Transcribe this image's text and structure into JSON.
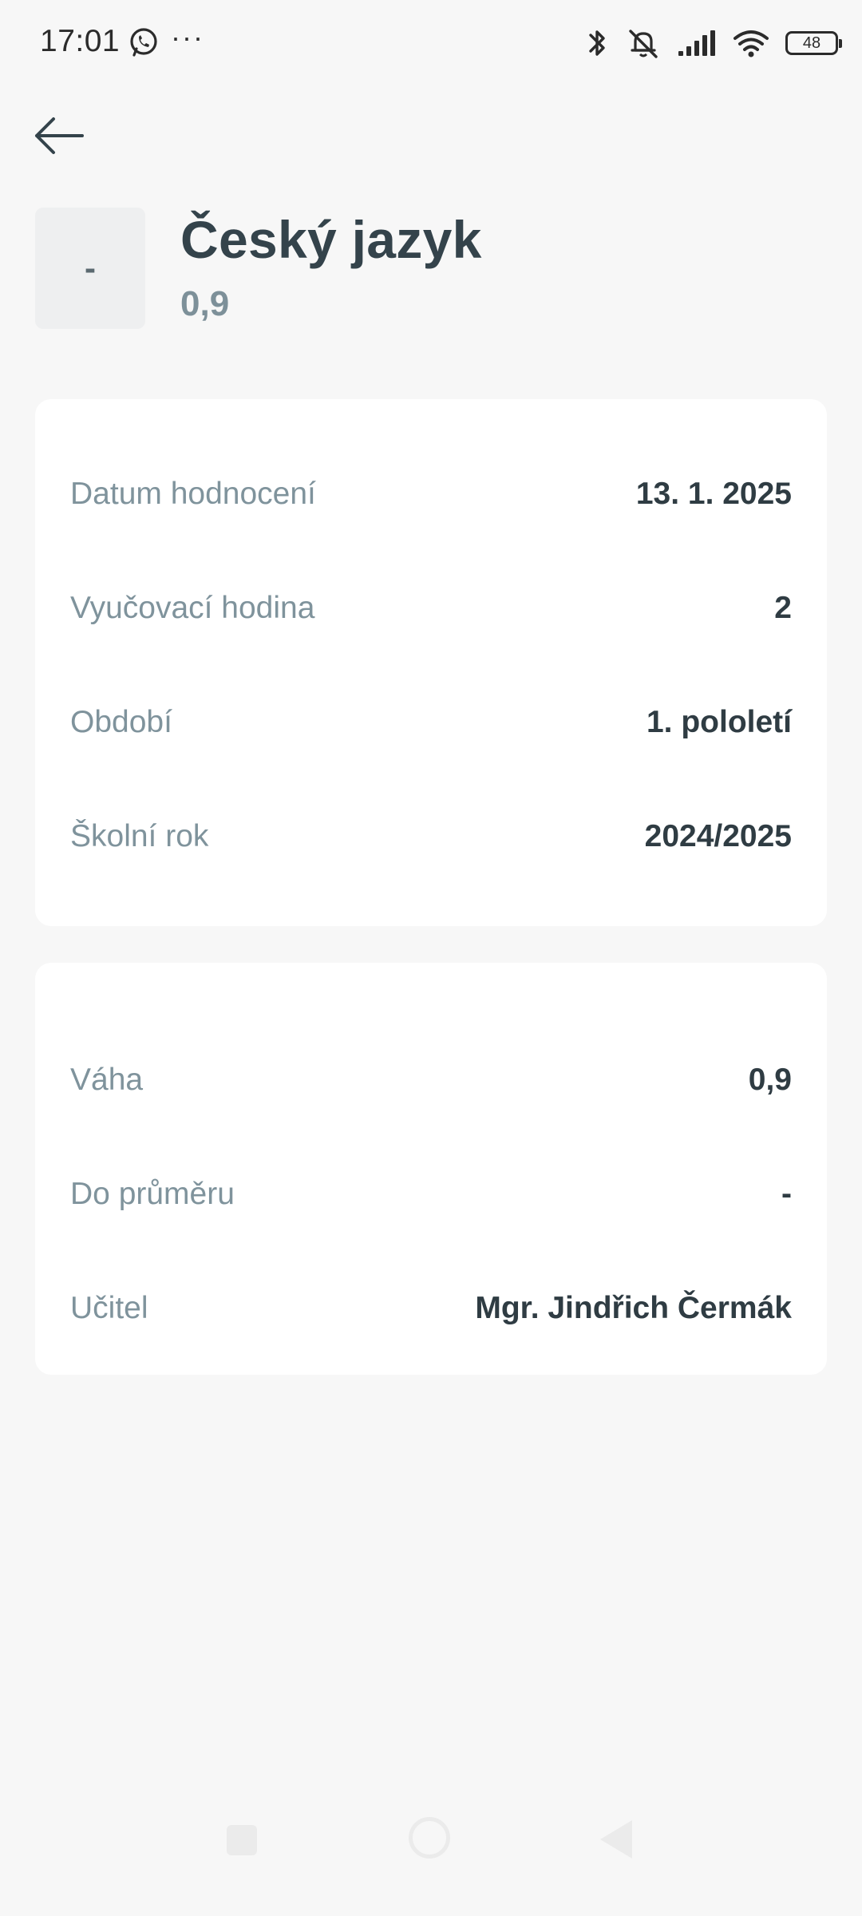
{
  "status_bar": {
    "time": "17:01",
    "more": "···",
    "battery": "48",
    "icons": [
      "whatsapp-icon",
      "bluetooth-icon",
      "muted-bell-icon",
      "signal-icon",
      "wifi-icon",
      "battery-icon"
    ]
  },
  "header": {
    "grade": "-",
    "subject": "Český jazyk",
    "weight": "0,9"
  },
  "details": [
    {
      "label": "Datum hodnocení",
      "value": "13. 1. 2025"
    },
    {
      "label": "Vyučovací hodina",
      "value": "2"
    },
    {
      "label": "Období",
      "value": "1. pololetí"
    },
    {
      "label": "Školní rok",
      "value": "2024/2025"
    }
  ],
  "extra": [
    {
      "label": "Váha",
      "value": "0,9"
    },
    {
      "label": "Do průměru",
      "value": "-"
    },
    {
      "label": "Učitel",
      "value": "Mgr. Jindřich Čermák"
    }
  ],
  "colors": {
    "background": "#f7f7f7",
    "card": "#ffffff",
    "title": "#34434b",
    "label": "#7f939c",
    "accent_muted": "#7d9099"
  }
}
